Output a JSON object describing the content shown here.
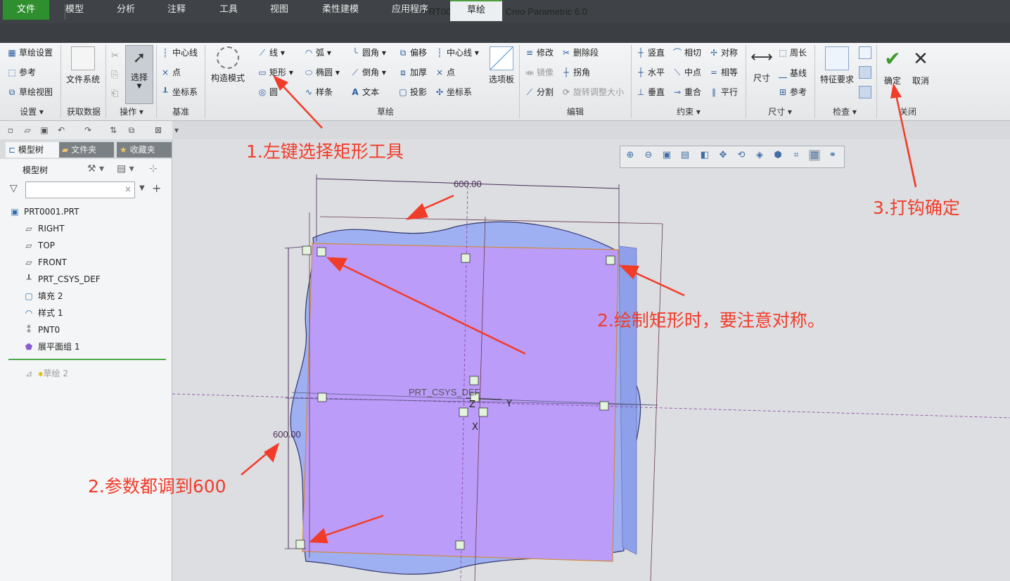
{
  "window": {
    "title": "PRT0001 (活动的) - Creo Parametric 6.0",
    "logo": "creo"
  },
  "tabs": [
    "文件",
    "模型",
    "分析",
    "注释",
    "工具",
    "视图",
    "柔性建模",
    "应用程序",
    "草绘"
  ],
  "ribbon": {
    "setup": {
      "items": [
        "草绘设置",
        "参考",
        "草绘视图"
      ],
      "label": "设置"
    },
    "get_data": {
      "button": "文件系统",
      "label": "获取数据"
    },
    "operations": {
      "button": "选择",
      "label": "操作"
    },
    "datum": {
      "items": [
        "中心线",
        "点",
        "坐标系"
      ],
      "label": "基准"
    },
    "construction": {
      "button": "构造模式"
    },
    "sketch": {
      "col1": [
        "线",
        "矩形",
        "圆"
      ],
      "col2": [
        "弧",
        "椭圆",
        "样条"
      ],
      "col3": [
        "圆角",
        "倒角",
        "文本"
      ],
      "col4": [
        "偏移",
        "加厚",
        "投影"
      ],
      "col5": [
        "中心线",
        "点",
        "坐标系"
      ],
      "palette": "选项板",
      "label": "草绘"
    },
    "edit": {
      "items": [
        "修改",
        "删除段",
        "镜像",
        "拐角",
        "分割",
        "旋转调整大小"
      ],
      "label": "编辑"
    },
    "constrain": {
      "items": [
        "竖直",
        "相切",
        "对称",
        "水平",
        "中点",
        "相等",
        "垂直",
        "重合",
        "平行"
      ],
      "label": "约束"
    },
    "dimension": {
      "button": "尺寸",
      "items": [
        "周长",
        "基线",
        "参考"
      ],
      "label": "尺寸"
    },
    "inspect": {
      "button": "特征要求",
      "label": "检查"
    },
    "close": {
      "ok": "确定",
      "cancel": "取消",
      "label": "关闭"
    }
  },
  "panel": {
    "tabs": [
      "模型树",
      "文件夹",
      "收藏夹"
    ],
    "tree_header": "模型树",
    "search_placeholder": "",
    "items": [
      "PRT0001.PRT",
      "RIGHT",
      "TOP",
      "FRONT",
      "PRT_CSYS_DEF",
      "填充 2",
      "样式 1",
      "PNT0",
      "展平面组 1"
    ],
    "active_item": "草绘 2"
  },
  "canvas": {
    "dim_horizontal": "600.00",
    "dim_vertical": "600.00",
    "csys_label": "PRT_CSYS_DEF",
    "axis_x": "X",
    "axis_y": "Y",
    "axis_z": "Z"
  },
  "annotations": {
    "step1": "1.左键选择矩形工具",
    "step2a": "2.绘制矩形时，要注意对称。",
    "step2b": "2.参数都调到600",
    "step3": "3.打钩确定"
  },
  "colors": {
    "accent_green": "#2f8f2f",
    "annotation_red": "#f23c2a",
    "rect_fill": "#bb9cf8",
    "surface_fill": "#9fb0f2"
  }
}
